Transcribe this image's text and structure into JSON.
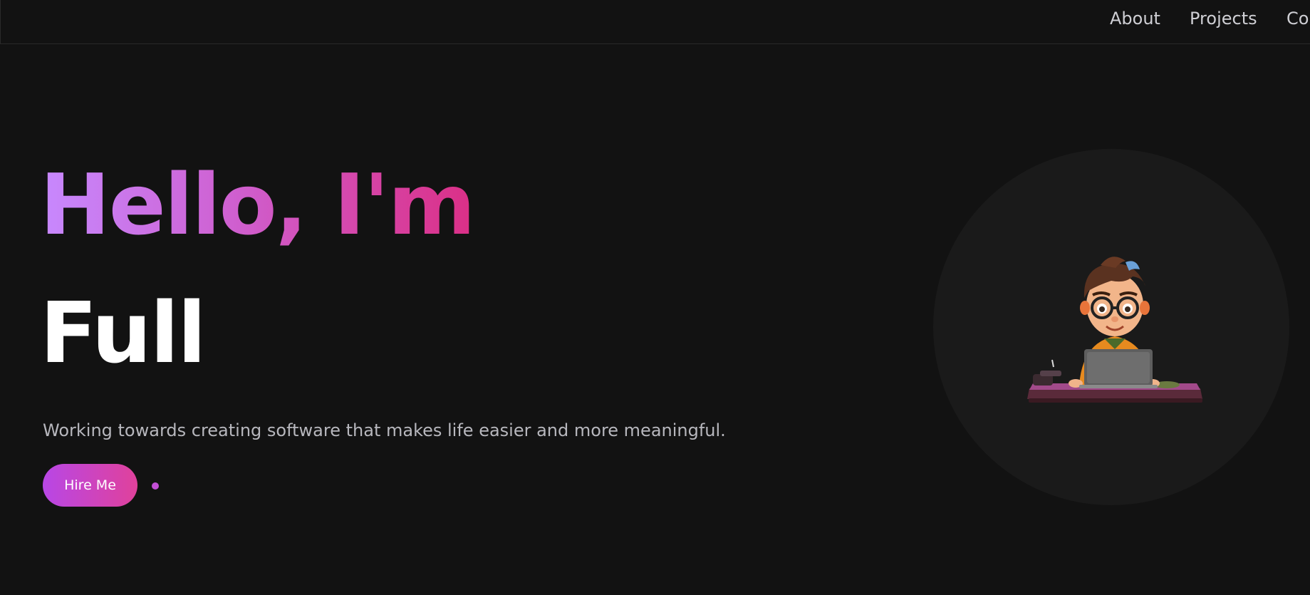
{
  "nav": {
    "about": "About",
    "projects": "Projects",
    "contact": "Co"
  },
  "hero": {
    "greeting": "Hello, I'm",
    "role": "Full",
    "subtitle": "Working towards creating software that makes life easier and more meaningful.",
    "cta_label": "Hire Me"
  },
  "colors": {
    "background": "#121212",
    "accent_start": "#b847e6",
    "accent_end": "#e0419b",
    "nav_text": "#cfcfd4",
    "subtitle_text": "#b7b7bd"
  },
  "icons": {
    "avatar": "developer-avatar-illustration",
    "indicator": "dot-indicator"
  }
}
